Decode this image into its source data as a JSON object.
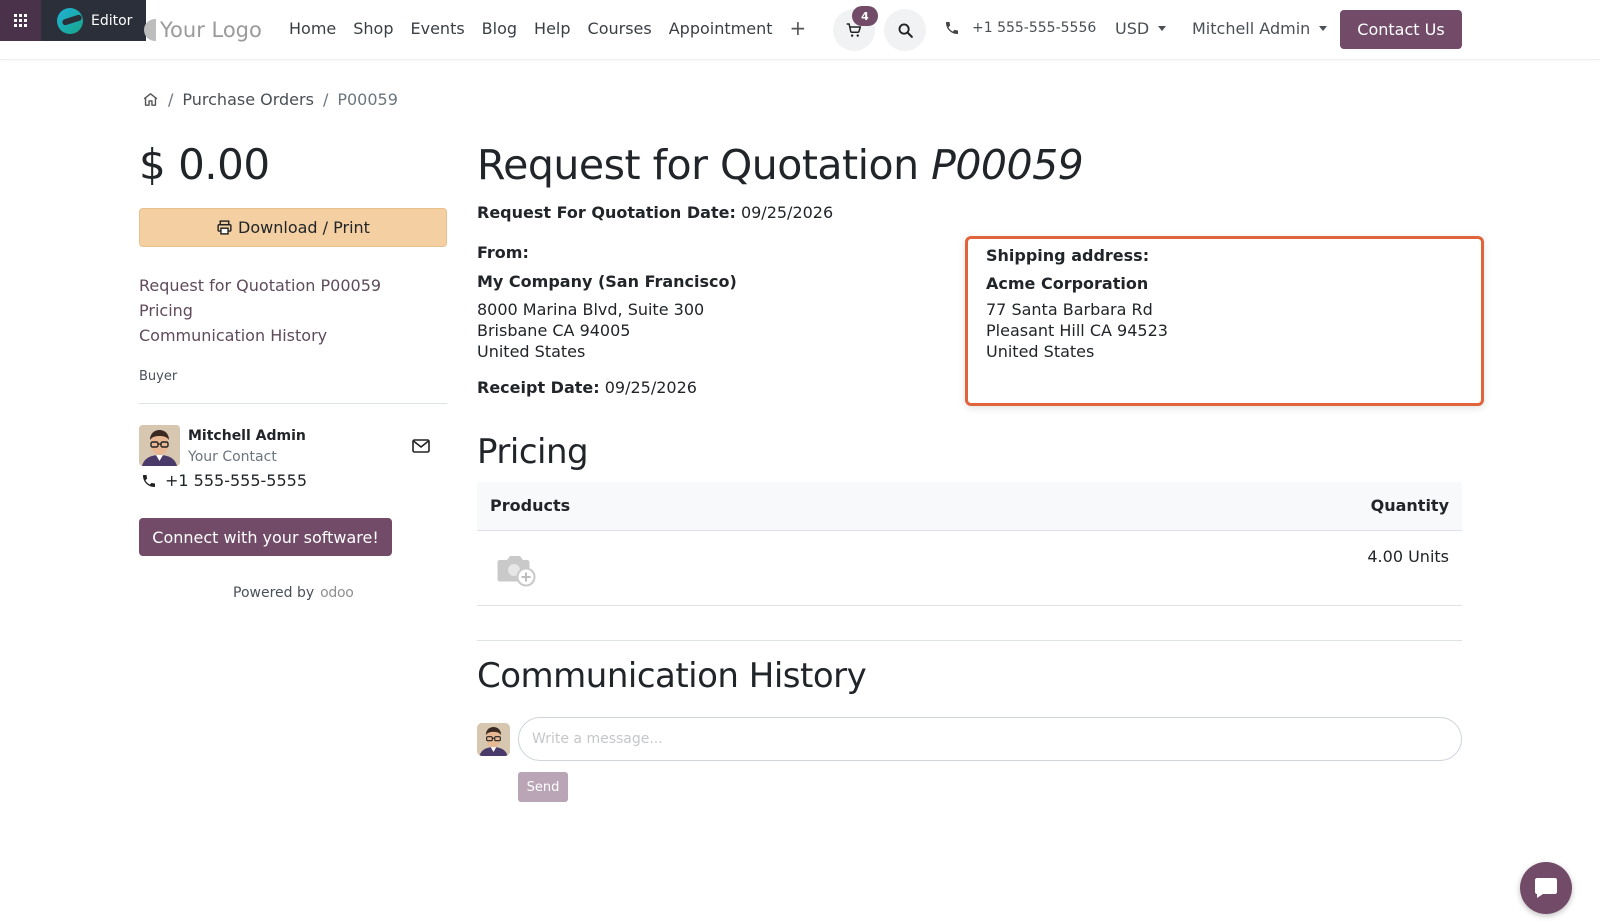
{
  "editor": {
    "label": "Editor"
  },
  "brand": {
    "logo_text": "Your Logo"
  },
  "nav": {
    "items": [
      "Home",
      "Shop",
      "Events",
      "Blog",
      "Help",
      "Courses",
      "Appointment"
    ],
    "add_label": "+"
  },
  "cart": {
    "count": "4"
  },
  "header": {
    "phone": "+1 555-555-5556",
    "currency": "USD",
    "user": "Mitchell Admin",
    "contact_button": "Contact Us"
  },
  "breadcrumb": {
    "items": [
      "Purchase Orders",
      "P00059"
    ],
    "separator": "/"
  },
  "sidebar": {
    "amount": "$ 0.00",
    "download_label": "Download / Print",
    "toc": [
      "Request for Quotation P00059",
      "Pricing",
      "Communication History"
    ],
    "buyer_label": "Buyer",
    "buyer_name": "Mitchell Admin",
    "buyer_role": "Your Contact",
    "buyer_phone": "+1 555-555-5555",
    "connect_label": "Connect with your software!",
    "powered_by": "Powered by",
    "powered_brand": "odoo"
  },
  "document": {
    "title_prefix": "Request for Quotation",
    "reference": "P00059",
    "rfq_date_label": "Request For Quotation Date:",
    "rfq_date": "09/25/2026",
    "from_label": "From:",
    "from_company": "My Company (San Francisco)",
    "from_address": [
      "8000 Marina Blvd, Suite 300",
      "Brisbane CA 94005",
      "United States"
    ],
    "receipt_date_label": "Receipt Date:",
    "receipt_date": "09/25/2026",
    "shipping_label": "Shipping address:",
    "shipping_company": "Acme Corporation",
    "shipping_address": [
      "77 Santa Barbara Rd",
      "Pleasant Hill CA 94523",
      "United States"
    ]
  },
  "pricing": {
    "heading": "Pricing",
    "columns": [
      "Products",
      "Quantity"
    ],
    "rows": [
      {
        "product": "",
        "quantity": "4.00 Units"
      }
    ]
  },
  "history": {
    "heading": "Communication History",
    "placeholder": "Write a message...",
    "send_label": "Send"
  },
  "colors": {
    "primary": "#714b67",
    "download_bg": "#f3cfa2",
    "highlight_border": "#e0643b"
  }
}
